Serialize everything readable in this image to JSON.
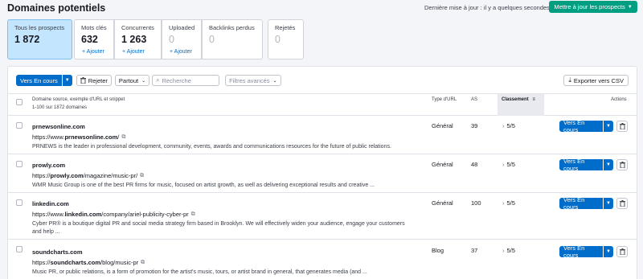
{
  "header": {
    "title": "Domaines potentiels",
    "updated": "Dernière mise à jour : il y a quelques secondes",
    "update_button": "Mettre à jour les prospects"
  },
  "stats": [
    {
      "label": "Tous les prospects",
      "value": "1 872",
      "add": ""
    },
    {
      "label": "Mots clés",
      "value": "632",
      "add": "+ Ajouter"
    },
    {
      "label": "Concurrents",
      "value": "1 263",
      "add": "+ Ajouter"
    },
    {
      "label": "Uploaded",
      "value": "0",
      "add": "+ Ajouter"
    },
    {
      "label": "Backlinks perdus",
      "value": "0",
      "add": ""
    },
    {
      "label": "Rejetés",
      "value": "0",
      "add": ""
    }
  ],
  "toolbar": {
    "status_button": "Vers En cours",
    "reject_button": "Rejeter",
    "partout": "Partout",
    "search_placeholder": "Recherche",
    "filters": "Filtres avancés",
    "export": "Exporter vers CSV"
  },
  "table": {
    "col_source": "Domaine source, exemple d'URL et snippet",
    "col_source_sub": "1-100 sur 1872 domaines",
    "col_type": "Type d'URL",
    "col_as": "AS",
    "col_rank": "Classement",
    "col_actions": "Actions",
    "rows": [
      {
        "domain": "prnewsonline.com",
        "url_prefix": "https://www.",
        "url_bold": "prnewsonline.com",
        "url_suffix": "/",
        "snippet": "PRNEWS is the leader in professional development, community, events, awards and communications resources for the future of public relations.",
        "type": "Général",
        "as": "39",
        "rank": "5/5",
        "action": "Vers En cours"
      },
      {
        "domain": "prowly.com",
        "url_prefix": "https://",
        "url_bold": "prowly.com",
        "url_suffix": "/magazine/music-pr/",
        "snippet": "WMR Music Group is one of the best PR firms for music, focused on artist growth, as well as delivering exceptional results and creative ...",
        "type": "Général",
        "as": "48",
        "rank": "5/5",
        "action": "Vers En cours"
      },
      {
        "domain": "linkedin.com",
        "url_prefix": "https://www.",
        "url_bold": "linkedin.com",
        "url_suffix": "/company/ariel-publicity-cyber-pr",
        "snippet": "Cyber PR® is a boutique digital PR and social media strategy firm based in Brooklyn. We will effectively widen your audience, engage your customers and help ...",
        "type": "Général",
        "as": "100",
        "rank": "5/5",
        "action": "Vers En cours"
      },
      {
        "domain": "soundcharts.com",
        "url_prefix": "https://",
        "url_bold": "soundcharts.com",
        "url_suffix": "/blog/music-pr",
        "snippet": "Music PR, or public relations, is a form of promotion for the artist's music, tours, or artist brand in general, that generates media (and ...",
        "type": "Blog",
        "as": "37",
        "rank": "5/5",
        "action": "Vers En cours"
      }
    ]
  },
  "colors": {
    "primary": "#006dca",
    "green": "#009f81",
    "active_card": "#c4e5fe"
  }
}
